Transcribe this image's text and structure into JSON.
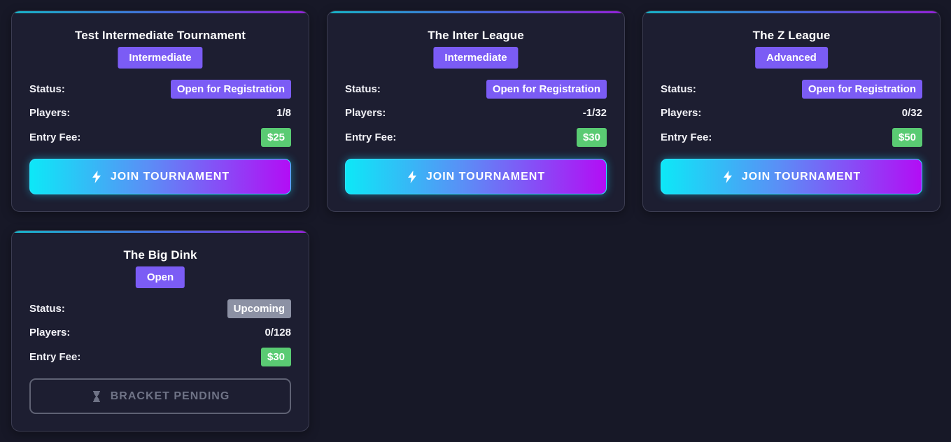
{
  "cards": [
    {
      "title": "Test Intermediate Tournament",
      "level": "Intermediate",
      "status_label": "Status:",
      "status": "Open for Registration",
      "players_label": "Players:",
      "players": "1/8",
      "fee_label": "Entry Fee:",
      "fee": "$25",
      "button": "JOIN TOURNAMENT",
      "button_icon": "lightning-icon"
    },
    {
      "title": "The Inter League",
      "level": "Intermediate",
      "status_label": "Status:",
      "status": "Open for Registration",
      "players_label": "Players:",
      "players": "-1/32",
      "fee_label": "Entry Fee:",
      "fee": "$30",
      "button": "JOIN TOURNAMENT",
      "button_icon": "lightning-icon"
    },
    {
      "title": "The Z League",
      "level": "Advanced",
      "status_label": "Status:",
      "status": "Open for Registration",
      "players_label": "Players:",
      "players": "0/32",
      "fee_label": "Entry Fee:",
      "fee": "$50",
      "button": "JOIN TOURNAMENT",
      "button_icon": "lightning-icon"
    },
    {
      "title": "The Big Dink",
      "level": "Open",
      "status_label": "Status:",
      "status": "Upcoming",
      "players_label": "Players:",
      "players": "0/128",
      "fee_label": "Entry Fee:",
      "fee": "$30",
      "button": "BRACKET PENDING",
      "button_icon": "hourglass-icon"
    }
  ],
  "colors": {
    "background": "#171827",
    "card": "#1d1e31",
    "level_badge": "#7b5cf5",
    "status_open": "#7b5cf5",
    "status_upcoming": "#8c91a4",
    "fee_badge": "#5acb73",
    "join_gradient_start": "#0de8f7",
    "join_gradient_end": "#b30df5"
  }
}
